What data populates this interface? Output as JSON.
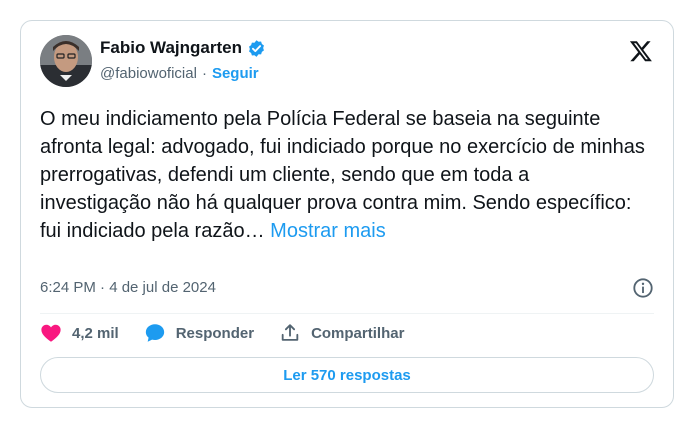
{
  "tweet": {
    "author_name": "Fabio Wajngarten",
    "handle": "@fabiowoficial",
    "separator": "·",
    "follow_label": "Seguir",
    "text": "O meu indiciamento pela Polícia Federal se baseia na seguinte afronta legal: advogado, fui indiciado porque no exercício de minhas prerrogativas, defendi um cliente, sendo que em toda a investigação não há qualquer prova contra mim. Sendo específico: fui indiciado pela razão…",
    "show_more_label": "Mostrar mais",
    "timestamp": "6:24 PM · 4 de jul de 2024",
    "likes": "4,2 mil",
    "reply_label": "Responder",
    "share_label": "Compartilhar",
    "read_replies_label": "Ler 570 respostas"
  },
  "colors": {
    "accent": "#1d9bf0",
    "like": "#f91880",
    "text": "#0f1419",
    "muted": "#536471",
    "border": "#cfd9de"
  },
  "icons": [
    "verified-badge-icon",
    "x-logo-icon",
    "info-icon",
    "heart-icon",
    "reply-bubble-icon",
    "share-icon"
  ]
}
